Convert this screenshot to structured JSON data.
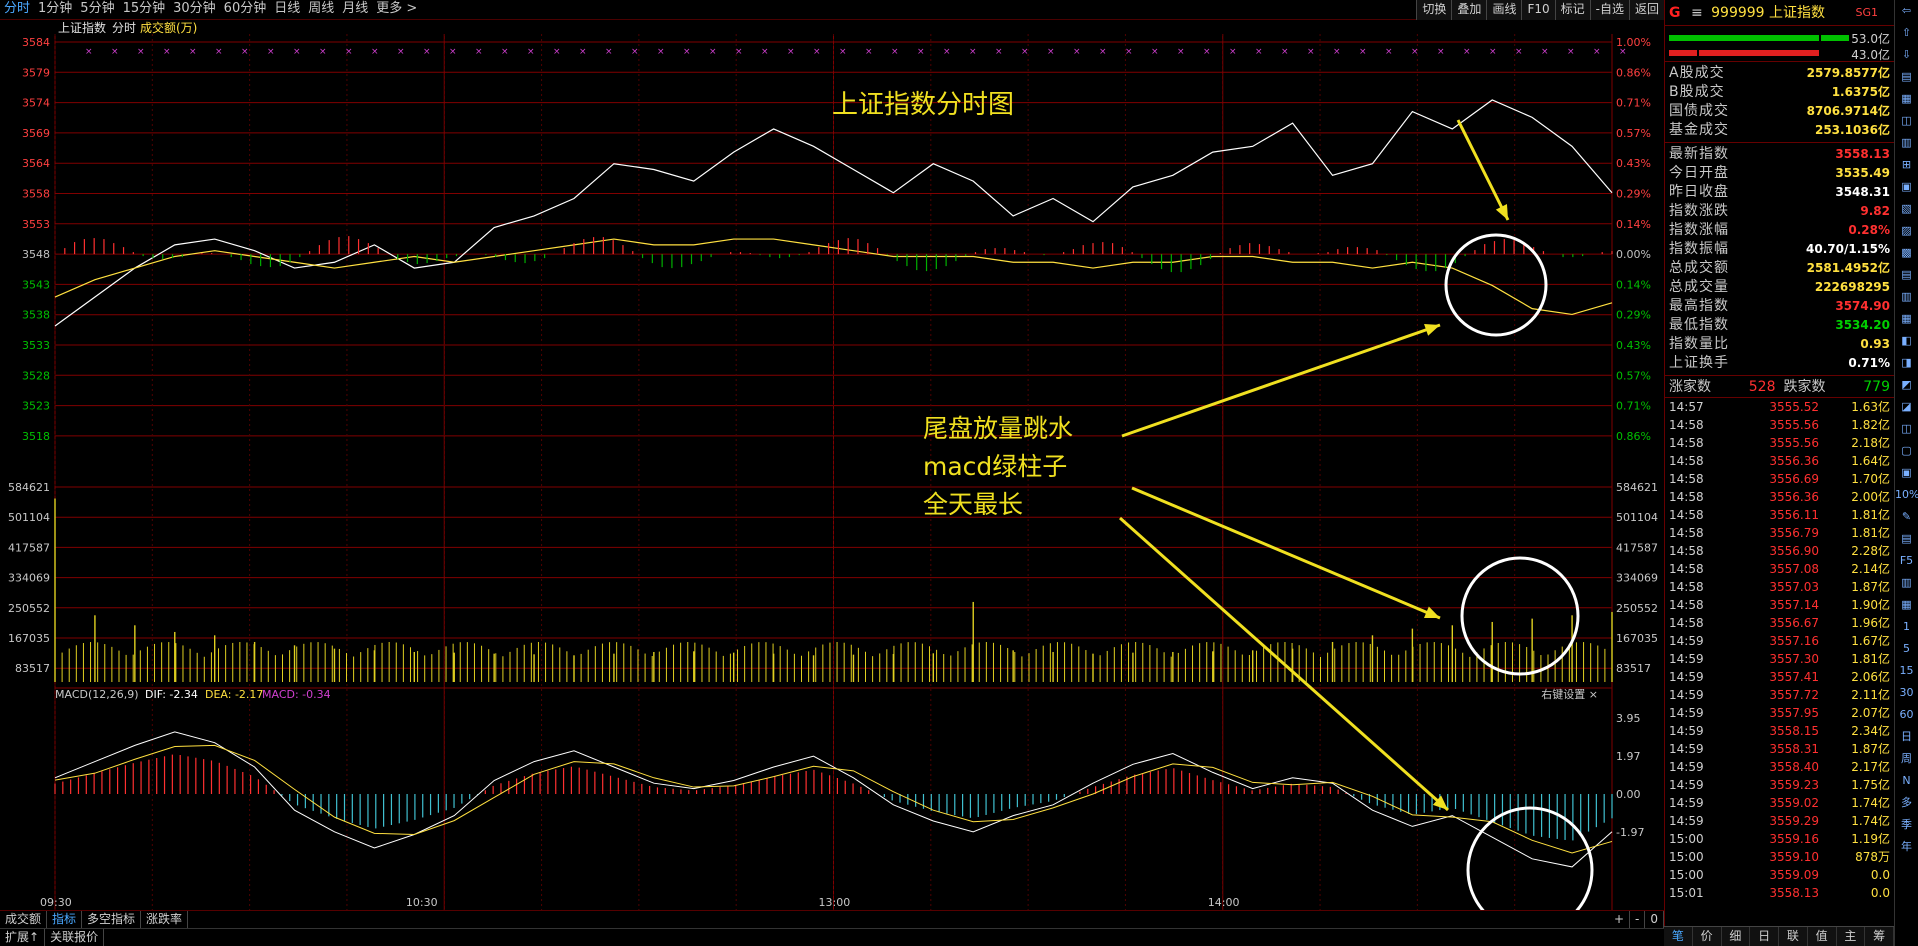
{
  "toolbar": {
    "periods": [
      "分时",
      "1分钟",
      "5分钟",
      "15分钟",
      "30分钟",
      "60分钟",
      "日线",
      "周线",
      "月线",
      "更多 >"
    ],
    "tools": [
      "切换",
      "叠加",
      "画线",
      "F10",
      "标记",
      "-自选",
      "返回"
    ]
  },
  "main_chart": {
    "legend_name": "上证指数",
    "legend_mode": "分时",
    "legend_series": "成交额(万)",
    "price_axis": [
      "3584",
      "3579",
      "3574",
      "3569",
      "3564",
      "3558",
      "3553",
      "3548",
      "3543",
      "3538",
      "3533",
      "3528",
      "3523",
      "3518"
    ],
    "pct_axis": [
      "1.00%",
      "0.86%",
      "0.71%",
      "0.57%",
      "0.43%",
      "0.29%",
      "0.14%",
      "0.00%",
      "0.14%",
      "0.29%",
      "0.43%",
      "0.57%",
      "0.71%",
      "0.86%"
    ],
    "volume_axis": [
      "584621",
      "501104",
      "417587",
      "334069",
      "250552",
      "167035",
      "83517"
    ],
    "macd_axis": [
      "3.95",
      "1.97",
      "0.00",
      "-1.97"
    ],
    "macd_legend": {
      "name": "MACD(12,26,9)",
      "dif": "DIF: -2.34",
      "dea": "DEA: -2.17",
      "macd": "MACD: -0.34"
    },
    "right_setting": "右键设置",
    "time_axis": [
      "09:30",
      "10:30",
      "13:00",
      "14:00"
    ]
  },
  "chart_data": [
    {
      "type": "line",
      "title": "上证指数分时图",
      "ylim": [
        3513,
        3584
      ],
      "series": [
        {
          "values": [
            3535,
            3540,
            3545,
            3549,
            3550,
            3548,
            3545,
            3546,
            3549,
            3545,
            3546,
            3552,
            3554,
            3557,
            3563,
            3562,
            3560,
            3565,
            3569,
            3566,
            3562,
            3558,
            3563,
            3560,
            3554,
            3557,
            3553,
            3559,
            3561,
            3565,
            3566,
            3570,
            3561,
            3563,
            3572,
            3569,
            3574,
            3571,
            3566,
            3558
          ]
        },
        {
          "values": [
            3540,
            3543,
            3545,
            3547,
            3548,
            3547,
            3546,
            3545,
            3546,
            3547,
            3546,
            3547,
            3548,
            3549,
            3550,
            3549,
            3549,
            3550,
            3550,
            3549,
            3548,
            3547,
            3547,
            3547,
            3546,
            3546,
            3545,
            3546,
            3546,
            3547,
            3547,
            3546,
            3546,
            3545,
            3546,
            3545,
            3542,
            3538,
            3537,
            3539
          ]
        }
      ]
    },
    {
      "type": "bar",
      "ylim": [
        0,
        584621
      ],
      "values": [
        550000,
        200000,
        170000,
        150000,
        140000,
        120000,
        110000,
        100000,
        95000,
        90000,
        88000,
        85000,
        83000,
        80000,
        85000,
        90000,
        92000,
        88000,
        85000,
        80000,
        82000,
        84000,
        86000,
        240000,
        95000,
        90000,
        85000,
        88000,
        90000,
        92000,
        95000,
        100000,
        120000,
        140000,
        160000,
        170000,
        180000,
        190000,
        200000,
        210000
      ]
    },
    {
      "type": "bar",
      "ylim": [
        -3.95,
        3.95
      ],
      "values": [
        0.6,
        1.2,
        1.8,
        2.3,
        1.9,
        1.0,
        -0.6,
        -1.4,
        -2.0,
        -1.5,
        -0.8,
        0.5,
        1.2,
        1.6,
        1.0,
        0.4,
        0.2,
        0.5,
        1.0,
        1.4,
        0.6,
        -0.4,
        -1.0,
        -1.4,
        -0.8,
        -0.4,
        0.4,
        1.1,
        1.5,
        0.8,
        0.2,
        0.6,
        0.4,
        -0.6,
        -1.2,
        -0.8,
        -1.6,
        -2.4,
        -2.7,
        -1.4
      ]
    }
  ],
  "annotations": {
    "line1": "尾盘放量跳水",
    "line2": "macd绿柱子",
    "line3": "全天最长"
  },
  "right_panel": {
    "g_label": "G",
    "code": "999999 上证指数",
    "sg": "SG1",
    "ratio_up": "53.0亿",
    "ratio_down": "43.0亿",
    "turnover": [
      {
        "k": "A股成交",
        "v": "2579.8577亿"
      },
      {
        "k": "B股成交",
        "v": "1.6375亿"
      },
      {
        "k": "国债成交",
        "v": "8706.9714亿"
      },
      {
        "k": "基金成交",
        "v": "253.1036亿"
      }
    ],
    "stats": [
      {
        "k": "最新指数",
        "v": "3558.13",
        "c": "#ff3030"
      },
      {
        "k": "今日开盘",
        "v": "3535.49",
        "c": "#ffe040"
      },
      {
        "k": "昨日收盘",
        "v": "3548.31",
        "c": "#ffffff"
      },
      {
        "k": "指数涨跌",
        "v": "9.82",
        "c": "#ff3030"
      },
      {
        "k": "指数涨幅",
        "v": "0.28%",
        "c": "#ff3030"
      },
      {
        "k": "指数振幅",
        "v": "40.70/1.15%",
        "c": "#ffffff"
      },
      {
        "k": "总成交额",
        "v": "2581.4952亿",
        "c": "#ffe040"
      },
      {
        "k": "总成交量",
        "v": "222698295",
        "c": "#ffe040"
      },
      {
        "k": "最高指数",
        "v": "3574.90",
        "c": "#ff3030"
      },
      {
        "k": "最低指数",
        "v": "3534.20",
        "c": "#00d000"
      },
      {
        "k": "指数量比",
        "v": "0.93",
        "c": "#ffe040"
      },
      {
        "k": "上证换手",
        "v": "0.71%",
        "c": "#ffffff"
      }
    ],
    "up_label": "涨家数",
    "up_count": "528",
    "down_label": "跌家数",
    "down_count": "779",
    "ticks": [
      [
        "14:57",
        "3555.52",
        "1.63亿"
      ],
      [
        "14:58",
        "3555.56",
        "1.82亿"
      ],
      [
        "14:58",
        "3555.56",
        "2.18亿"
      ],
      [
        "14:58",
        "3556.36",
        "1.64亿"
      ],
      [
        "14:58",
        "3556.69",
        "1.70亿"
      ],
      [
        "14:58",
        "3556.36",
        "2.00亿"
      ],
      [
        "14:58",
        "3556.11",
        "1.81亿"
      ],
      [
        "14:58",
        "3556.79",
        "1.81亿"
      ],
      [
        "14:58",
        "3556.90",
        "2.28亿"
      ],
      [
        "14:58",
        "3557.08",
        "2.14亿"
      ],
      [
        "14:58",
        "3557.03",
        "1.87亿"
      ],
      [
        "14:58",
        "3557.14",
        "1.90亿"
      ],
      [
        "14:58",
        "3556.67",
        "1.96亿"
      ],
      [
        "14:59",
        "3557.16",
        "1.67亿"
      ],
      [
        "14:59",
        "3557.30",
        "1.81亿"
      ],
      [
        "14:59",
        "3557.41",
        "2.06亿"
      ],
      [
        "14:59",
        "3557.72",
        "2.11亿"
      ],
      [
        "14:59",
        "3557.95",
        "2.07亿"
      ],
      [
        "14:59",
        "3558.15",
        "2.34亿"
      ],
      [
        "14:59",
        "3558.31",
        "1.87亿"
      ],
      [
        "14:59",
        "3558.40",
        "2.17亿"
      ],
      [
        "14:59",
        "3559.23",
        "1.75亿"
      ],
      [
        "14:59",
        "3559.02",
        "1.74亿"
      ],
      [
        "14:59",
        "3559.29",
        "1.74亿"
      ],
      [
        "15:00",
        "3559.16",
        "1.19亿"
      ],
      [
        "15:00",
        "3559.10",
        "878万"
      ],
      [
        "15:00",
        "3559.09",
        "0.0"
      ],
      [
        "15:01",
        "3558.13",
        "0.0"
      ]
    ],
    "tabs": [
      "笔",
      "价",
      "细",
      "日",
      "联",
      "值",
      "主",
      "筹"
    ]
  },
  "icon_strip": [
    "⇦",
    "⇧",
    "⇩",
    "▤",
    "▦",
    "◫",
    "▥",
    "⊞",
    "▣",
    "▧",
    "▨",
    "▩",
    "▤",
    "▥",
    "▦",
    "◧",
    "◨",
    "◩",
    "◪",
    "◫",
    "▢",
    "▣",
    "10%",
    "✎",
    "▤",
    "F5",
    "▥",
    "▦",
    "1",
    "5",
    "15",
    "30",
    "60",
    "日",
    "周",
    "N",
    "多",
    "季",
    "年"
  ],
  "bottom_tabs": [
    "成交额",
    "指标",
    "多空指标",
    "涨跌率"
  ],
  "bottom_right": [
    "+",
    "-",
    "0"
  ],
  "status_tabs": [
    "扩展↑",
    "关联报价"
  ]
}
